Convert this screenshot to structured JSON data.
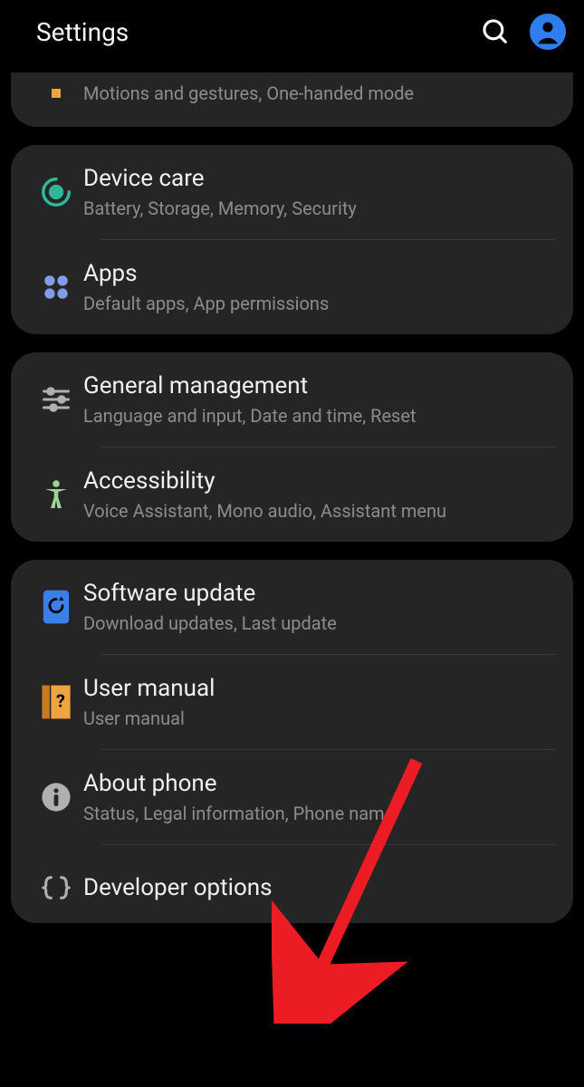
{
  "header": {
    "title": "Settings"
  },
  "truncated_row": {
    "sub": "Motions and gestures, One-handed mode"
  },
  "group1": {
    "device_care": {
      "title": "Device care",
      "sub": "Battery, Storage, Memory, Security"
    },
    "apps": {
      "title": "Apps",
      "sub": "Default apps, App permissions"
    }
  },
  "group2": {
    "general": {
      "title": "General management",
      "sub": "Language and input, Date and time, Reset"
    },
    "accessibility": {
      "title": "Accessibility",
      "sub": "Voice Assistant, Mono audio, Assistant menu"
    }
  },
  "group3": {
    "software": {
      "title": "Software update",
      "sub": "Download updates, Last update"
    },
    "manual": {
      "title": "User manual",
      "sub": "User manual"
    },
    "about": {
      "title": "About phone",
      "sub": "Status, Legal information, Phone name"
    },
    "developer": {
      "title": "Developer options"
    }
  },
  "colors": {
    "accent_blue": "#2f7ef0",
    "teal": "#2fb89a",
    "lilac": "#7f9de8",
    "green_pastel": "#9ad69a",
    "orange": "#f0a441",
    "gray": "#b0b0b0"
  }
}
